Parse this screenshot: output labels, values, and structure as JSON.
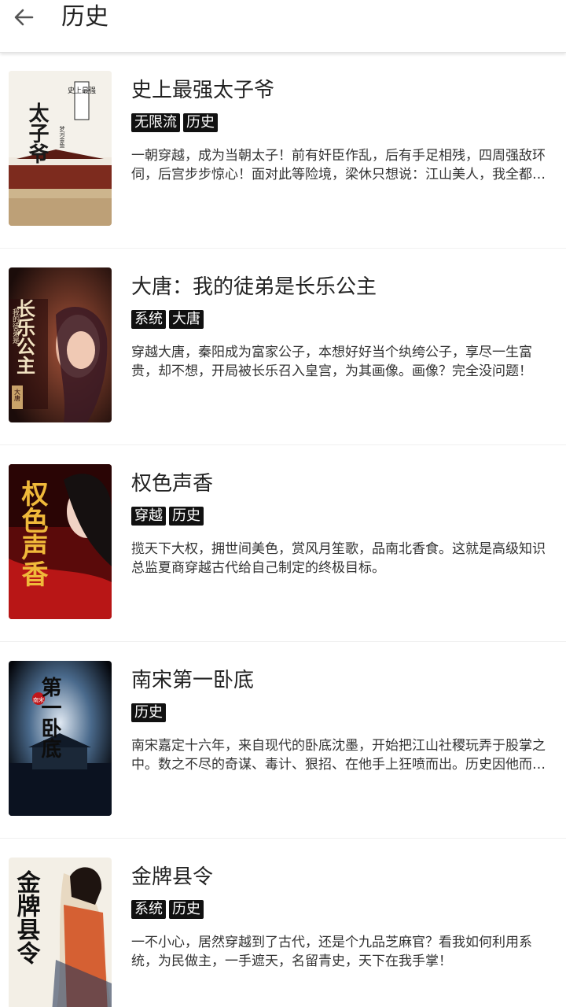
{
  "header": {
    "title": "历史",
    "back_icon": "arrow-left-icon"
  },
  "books": [
    {
      "title": "史上最强太子爷",
      "tags": [
        "无限流",
        "历史"
      ],
      "desc": "一朝穿越，成为当朝太子！前有奸臣作乱，后有手足相残，四周强敌环伺，后宫步步惊心！面对此等险境，梁休只想说：江山美人，我全都要！",
      "cover": {
        "title": "太子爷",
        "subtitle": "史上最强",
        "author": "梦河金鱼"
      }
    },
    {
      "title": "大唐：我的徒弟是长乐公主",
      "tags": [
        "系统",
        "大唐"
      ],
      "desc": "穿越大唐，秦阳成为富家公子，本想好好当个纨绔公子，享尽一生富贵，却不想，开局被长乐召入皇宫，为其画像。画像？完全没问题！",
      "cover": {
        "title": "长乐公主",
        "subtitle": "我的徒弟是",
        "author": "大唐"
      }
    },
    {
      "title": "权色声香",
      "tags": [
        "穿越",
        "历史"
      ],
      "desc": "揽天下大权，拥世间美色，赏风月笙歌，品南北香食。这就是高级知识总监夏商穿越古代给自己制定的终极目标。",
      "cover": {
        "title": "权色声香",
        "subtitle": "",
        "author": ""
      }
    },
    {
      "title": "南宋第一卧底",
      "tags": [
        "历史"
      ],
      "desc": "南宋嘉定十六年，来自现代的卧底沈墨，开始把江山社稷玩弄于股掌之中。数之不尽的奇谋、毒计、狠招、在他手上狂喷而出。历史因他而改变！",
      "cover": {
        "title": "第一卧底",
        "subtitle": "南宋",
        "author": ""
      }
    },
    {
      "title": "金牌县令",
      "tags": [
        "系统",
        "历史"
      ],
      "desc": "一不小心，居然穿越到了古代，还是个九品芝麻官？看我如何利用系统，为民做主，一手遮天，名留青史，天下在我手掌！",
      "cover": {
        "title": "金牌县令",
        "subtitle": "",
        "author": ""
      }
    }
  ]
}
